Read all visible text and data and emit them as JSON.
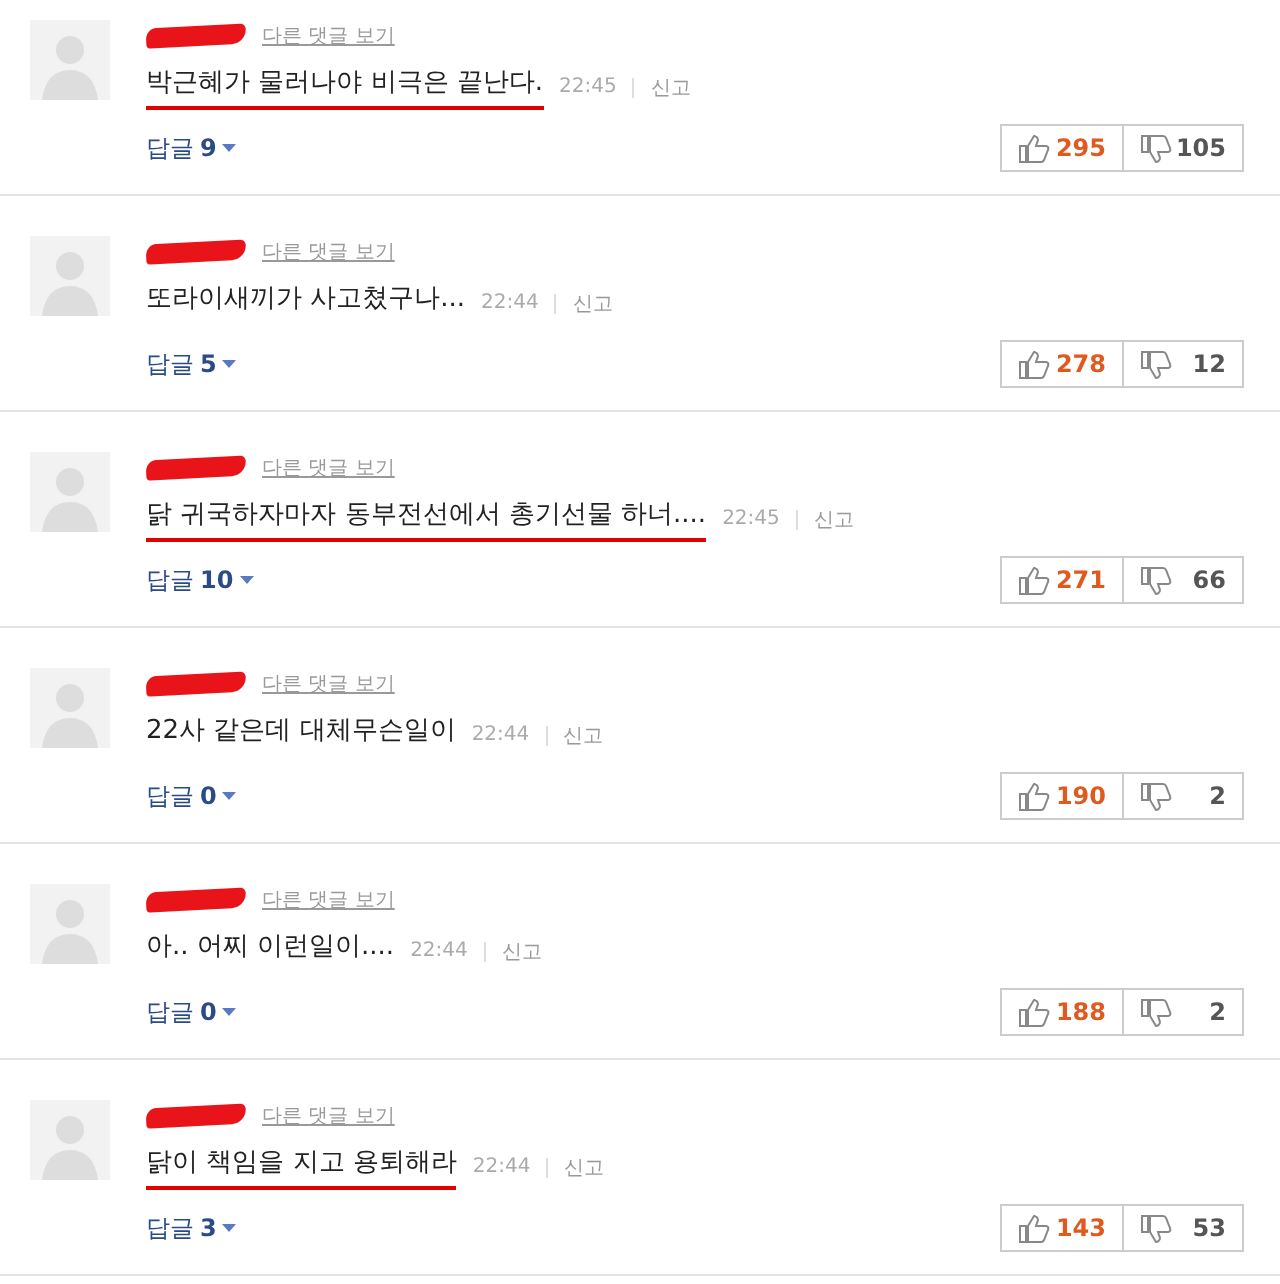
{
  "comments": [
    {
      "name_redacted": true,
      "more_link": "다른 댓글 보기",
      "text": "박근혜가 물러나야 비극은 끝난다.",
      "underlined": true,
      "time": "22:45",
      "report": "신고",
      "reply_label": "답글",
      "reply_count": "9",
      "likes": "295",
      "dislikes": "105"
    },
    {
      "name_redacted": true,
      "more_link": "다른 댓글 보기",
      "text": "또라이새끼가 사고쳤구나...",
      "underlined": false,
      "time": "22:44",
      "report": "신고",
      "reply_label": "답글",
      "reply_count": "5",
      "likes": "278",
      "dislikes": "12"
    },
    {
      "name_redacted": true,
      "more_link": "다른 댓글 보기",
      "text": "닭 귀국하자마자 동부전선에서 총기선물 하너....",
      "underlined": true,
      "time": "22:45",
      "report": "신고",
      "reply_label": "답글",
      "reply_count": "10",
      "likes": "271",
      "dislikes": "66"
    },
    {
      "name_redacted": true,
      "more_link": "다른 댓글 보기",
      "text": "22사 같은데 대체무슨일이",
      "underlined": false,
      "time": "22:44",
      "report": "신고",
      "reply_label": "답글",
      "reply_count": "0",
      "likes": "190",
      "dislikes": "2"
    },
    {
      "name_redacted": true,
      "more_link": "다른 댓글 보기",
      "text": "아.. 어찌 이런일이....",
      "underlined": false,
      "time": "22:44",
      "report": "신고",
      "reply_label": "답글",
      "reply_count": "0",
      "likes": "188",
      "dislikes": "2"
    },
    {
      "name_redacted": true,
      "more_link": "다른 댓글 보기",
      "text": "닭이 책임을 지고 용퇴해라",
      "underlined": true,
      "time": "22:44",
      "report": "신고",
      "reply_label": "답글",
      "reply_count": "3",
      "likes": "143",
      "dislikes": "53"
    }
  ]
}
